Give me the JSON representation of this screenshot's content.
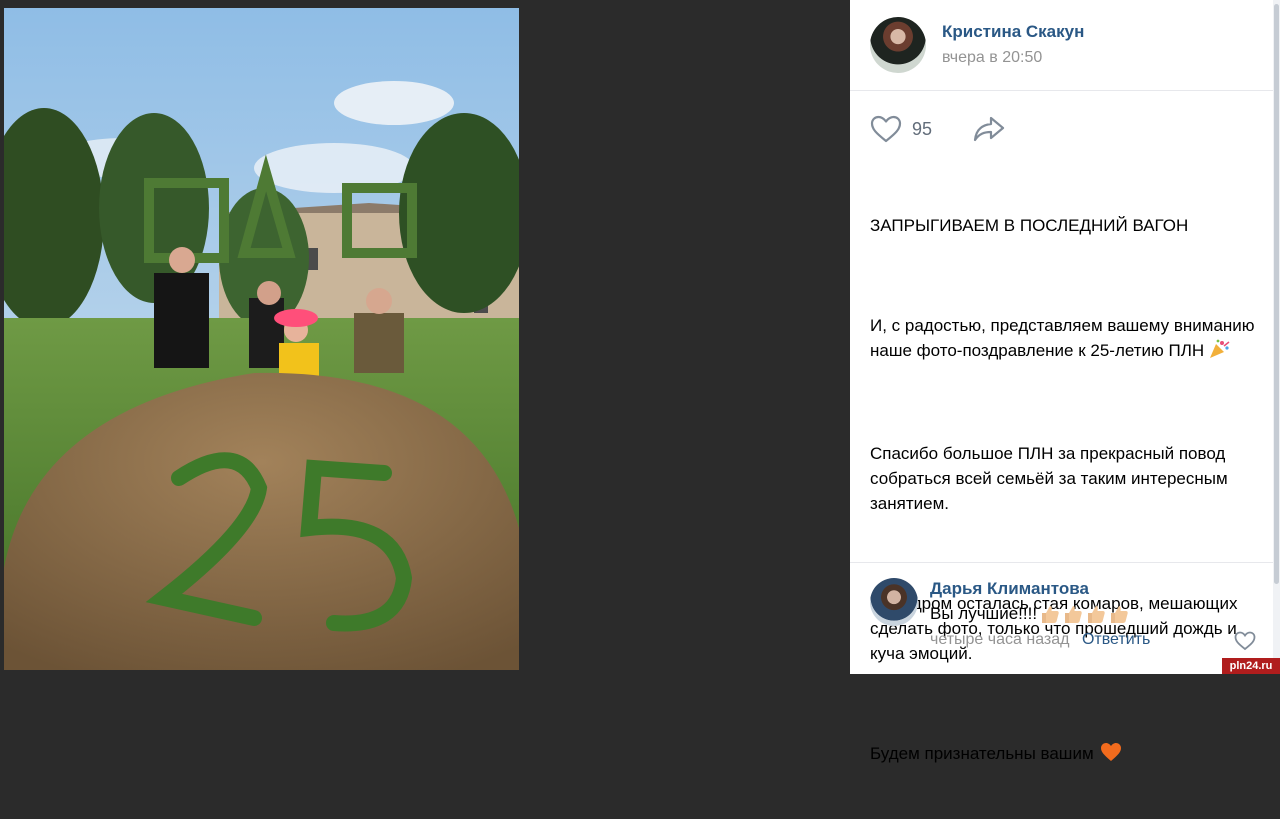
{
  "post": {
    "author": "Кристина Скакун",
    "time": "вчера в 20:50",
    "likes": "95",
    "paragraphs": [
      "ЗАПРЫГИВАЕМ В ПОСЛЕДНИЙ ВАГОН",
      "И, с радостью, представляем вашему вниманию наше фото-поздравление к 25-летию ПЛН",
      "Спасибо большое ПЛН за прекрасный повод собраться всей семьёй за таким интересным занятием.",
      "За кадром осталась стая комаров, мешающих сделать фото, только что прошедший дождь и куча эмоций.",
      "Будем признательны вашим"
    ]
  },
  "photo": {
    "hay_number": "25"
  },
  "comment": {
    "author": "Дарья Климантова",
    "text": "Вы лучшие!!!!",
    "time": "четыре часа назад",
    "reply": "Ответить"
  },
  "watermark": "pln24.ru",
  "icons": {
    "like": "heart-outline-icon",
    "share": "share-arrow-icon",
    "party": "party-popper-emoji",
    "heart": "orange-heart-emoji",
    "thumbs": "thumbs-up-emoji"
  },
  "colors": {
    "link": "#2a5885",
    "secondary": "#939393",
    "background_dark": "#2b2b2b"
  }
}
